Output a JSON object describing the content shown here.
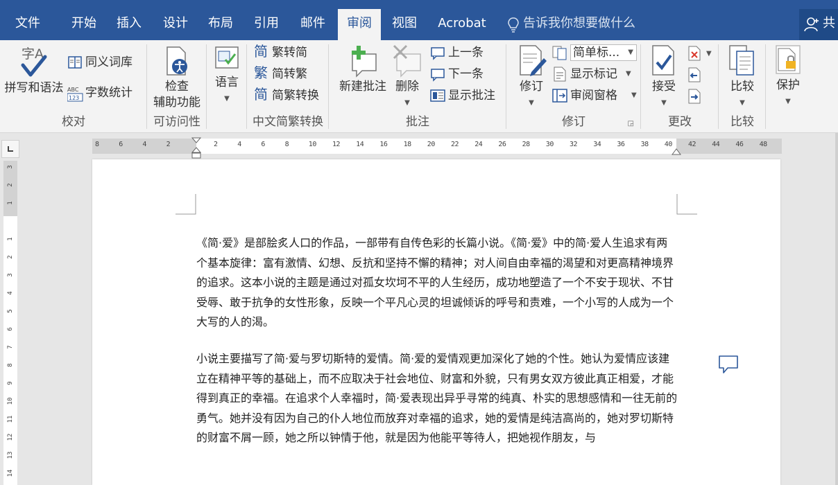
{
  "tabs": [
    {
      "label": "文件",
      "active": false
    },
    {
      "label": "开始",
      "active": false
    },
    {
      "label": "插入",
      "active": false
    },
    {
      "label": "设计",
      "active": false
    },
    {
      "label": "布局",
      "active": false
    },
    {
      "label": "引用",
      "active": false
    },
    {
      "label": "邮件",
      "active": false
    },
    {
      "label": "审阅",
      "active": true
    },
    {
      "label": "视图",
      "active": false
    },
    {
      "label": "Acrobat",
      "active": false
    }
  ],
  "tell_me": "告诉我你想要做什么",
  "share_label": "共",
  "colors": {
    "brand": "#2b579a",
    "ribbon_bg": "#f3f3f3",
    "doc_bg": "#e6e6e6",
    "icon_blue": "#2b579a",
    "icon_green": "#4caf50"
  },
  "ribbon": {
    "proofing": {
      "label": "校对",
      "spelling": "拼写和语法",
      "thesaurus": "同义词库",
      "wordcount": "字数统计",
      "abc_mark": "ABC",
      "num_mark": "123",
      "zi_mark": "字A"
    },
    "accessibility": {
      "label": "可访问性",
      "check_line1": "检查",
      "check_line2": "辅助功能"
    },
    "language": {
      "label": "语言"
    },
    "chinese_conv": {
      "label": "中文简繁转换",
      "to_simplified": "繁转简",
      "to_traditional": "简转繁",
      "conversion": "简繁转换",
      "glyph_jian": "简",
      "glyph_fan": "繁"
    },
    "comments": {
      "label": "批注",
      "new_comment": "新建批注",
      "delete": "删除",
      "previous": "上一条",
      "next": "下一条",
      "show_comments": "显示批注"
    },
    "tracking": {
      "label": "修订",
      "track_changes": "修订",
      "markup_select": "简单标...",
      "show_markup": "显示标记",
      "reviewing_pane": "审阅窗格"
    },
    "changes": {
      "label": "更改",
      "accept": "接受"
    },
    "compare": {
      "label": "比较",
      "compare": "比较"
    },
    "protect": {
      "label": "保护",
      "protect": "保护"
    }
  },
  "ruler": {
    "h_ticks": [
      "8",
      "6",
      "4",
      "2",
      "",
      "2",
      "4",
      "6",
      "8",
      "10",
      "12",
      "14",
      "16",
      "18",
      "20",
      "22",
      "24",
      "26",
      "28",
      "30",
      "32",
      "34",
      "36",
      "38",
      "40",
      "42",
      "44",
      "46",
      "48"
    ],
    "v_ticks": [
      "3",
      "2",
      "1",
      "",
      "1",
      "2",
      "3",
      "4",
      "5",
      "6",
      "7",
      "8",
      "9",
      "10",
      "11",
      "12",
      "13",
      "14"
    ]
  },
  "document": {
    "paragraphs": [
      "《简·爱》是部脍炙人口的作品，一部带有自传色彩的长篇小说。《简·爱》中的简·爱人生追求有两个基本旋律：富有激情、幻想、反抗和坚持不懈的精神；对人间自由幸福的渴望和对更高精神境界的追求。这本小说的主题是通过对孤女坎坷不平的人生经历，成功地塑造了一个不安于现状、不甘受辱、敢于抗争的女性形象，反映一个平凡心灵的坦诚倾诉的呼号和责难，一个小写的人成为一个大写的人的渴。",
      "小说主要描写了简·爱与罗切斯特的爱情。简·爱的爱情观更加深化了她的个性。她认为爱情应该建立在精神平等的基础上，而不应取决于社会地位、财富和外貌，只有男女双方彼此真正相爱，才能得到真正的幸福。在追求个人幸福时，简·爱表现出异乎寻常的纯真、朴实的思想感情和一往无前的勇气。她并没有因为自己的仆人地位而放弃对幸福的追求，她的爱情是纯洁高尚的，她对罗切斯特的财富不屑一顾，她之所以钟情于他，就是因为他能平等待人，把她视作朋友，与"
    ]
  }
}
